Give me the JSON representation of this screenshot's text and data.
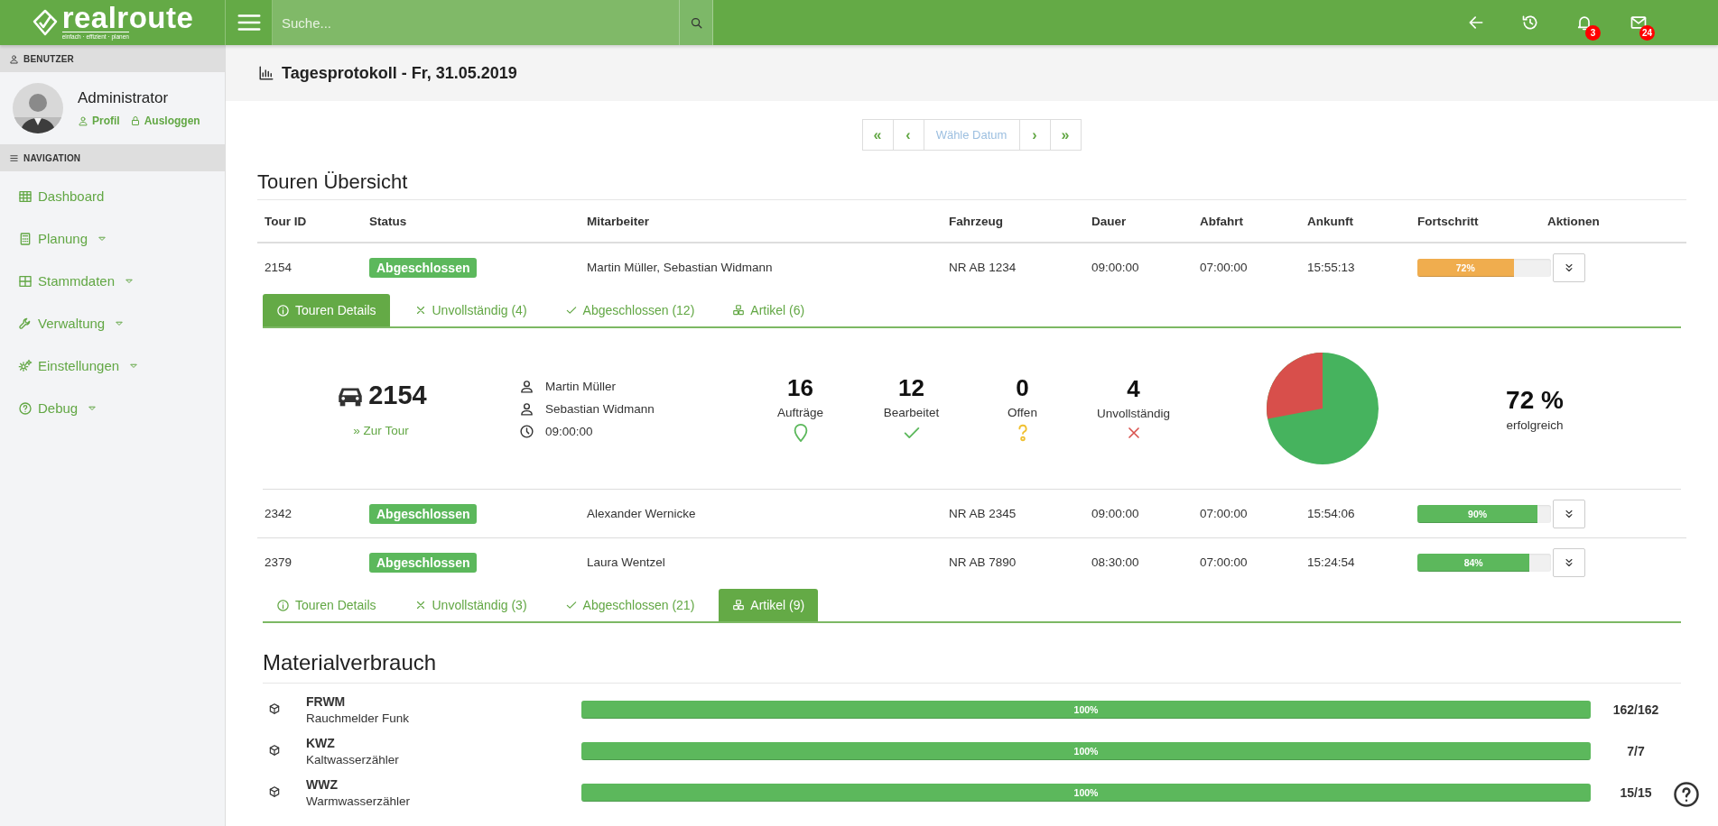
{
  "brand": {
    "name": "realroute",
    "tagline": "einfach · effizient · planen"
  },
  "search": {
    "placeholder": "Suche..."
  },
  "toolbar": [
    {
      "kind": "back"
    },
    {
      "kind": "history"
    },
    {
      "kind": "bell",
      "badge": "3"
    },
    {
      "kind": "mail",
      "badge": "24"
    }
  ],
  "sidebar": {
    "user_section": "BENUTZER",
    "user": {
      "name": "Administrator",
      "links": [
        {
          "kind": "profile",
          "label": "Profil"
        },
        {
          "kind": "logout",
          "label": "Ausloggen"
        }
      ]
    },
    "nav_section": "NAVIGATION",
    "items": [
      {
        "kind": "grid",
        "label": "Dashboard",
        "has_submenu": false
      },
      {
        "kind": "calculator",
        "label": "Planung",
        "has_submenu": true
      },
      {
        "kind": "columns",
        "label": "Stammdaten",
        "has_submenu": true
      },
      {
        "kind": "wrench",
        "label": "Verwaltung",
        "has_submenu": true
      },
      {
        "kind": "gears",
        "label": "Einstellungen",
        "has_submenu": true
      },
      {
        "kind": "question",
        "label": "Debug",
        "has_submenu": true
      }
    ]
  },
  "page": {
    "title": "Tagesprotokoll - Fr, 31.05.2019"
  },
  "date_pager": {
    "prev_buttons": [
      "«",
      "‹"
    ],
    "placeholder": "Wähle Datum",
    "next_buttons": [
      "›",
      "»"
    ]
  },
  "tours": {
    "title": "Touren Übersicht",
    "columns": [
      "Tour ID",
      "Status",
      "Mitarbeiter",
      "Fahrzeug",
      "Dauer",
      "Abfahrt",
      "Ankunft",
      "Fortschritt",
      "Aktionen"
    ],
    "rows": [
      {
        "id": "2154",
        "status": "Abgeschlossen",
        "staff": "Martin Müller, Sebastian Widmann",
        "vehicle": "NR AB 1234",
        "duration": "09:00:00",
        "departure": "07:00:00",
        "arrival": "15:55:13",
        "progress": {
          "level": 0.72,
          "label": "72%",
          "color": "#f0ad4e"
        },
        "expanded": true,
        "tabs": [
          {
            "kind": "info",
            "label": "Touren Details",
            "selected": true
          },
          {
            "kind": "cross",
            "label": "Unvollständig (4)",
            "selected": false
          },
          {
            "kind": "check",
            "label": "Abgeschlossen (12)",
            "selected": false
          },
          {
            "kind": "cubes",
            "label": "Artikel (6)",
            "selected": false
          }
        ],
        "panel": {
          "kind": "details",
          "tour_number": "2154",
          "link": "» Zur Tour",
          "people": [
            {
              "kind": "person",
              "text": "Martin Müller"
            },
            {
              "kind": "person",
              "text": "Sebastian Widmann"
            },
            {
              "kind": "clock",
              "text": "09:00:00"
            }
          ],
          "stats": [
            {
              "kind": "pin",
              "value": "16",
              "label": "Aufträge"
            },
            {
              "kind": "check",
              "value": "12",
              "label": "Bearbeitet"
            },
            {
              "kind": "question",
              "value": "0",
              "label": "Offen"
            },
            {
              "kind": "cross",
              "value": "4",
              "label": "Unvollständig"
            }
          ],
          "success": {
            "value": "72 %",
            "label": "erfolgreich"
          }
        }
      },
      {
        "id": "2342",
        "status": "Abgeschlossen",
        "staff": "Alexander Wernicke",
        "vehicle": "NR AB 2345",
        "duration": "09:00:00",
        "departure": "07:00:00",
        "arrival": "15:54:06",
        "progress": {
          "level": 0.9,
          "label": "90%",
          "color": "#5cb85c"
        },
        "expanded": false
      },
      {
        "id": "2379",
        "status": "Abgeschlossen",
        "staff": "Laura Wentzel",
        "vehicle": "NR AB 7890",
        "duration": "08:30:00",
        "departure": "07:00:00",
        "arrival": "15:24:54",
        "progress": {
          "level": 0.84,
          "label": "84%",
          "color": "#5cb85c"
        },
        "expanded": true,
        "tabs": [
          {
            "kind": "info",
            "label": "Touren Details",
            "selected": false
          },
          {
            "kind": "cross",
            "label": "Unvollständig (3)",
            "selected": false
          },
          {
            "kind": "check",
            "label": "Abgeschlossen (21)",
            "selected": false
          },
          {
            "kind": "cubes",
            "label": "Artikel (9)",
            "selected": true
          }
        ],
        "panel": {
          "kind": "materials",
          "title": "Materialverbrauch",
          "items": [
            {
              "code": "FRWM",
              "name": "Rauchmelder Funk",
              "level": 1,
              "label": "100%",
              "count": "162/162"
            },
            {
              "code": "KWZ",
              "name": "Kaltwasserzähler",
              "level": 1,
              "label": "100%",
              "count": "7/7"
            },
            {
              "code": "WWZ",
              "name": "Warmwasserzähler",
              "level": 1,
              "label": "100%",
              "count": "15/15"
            }
          ]
        }
      }
    ]
  }
}
